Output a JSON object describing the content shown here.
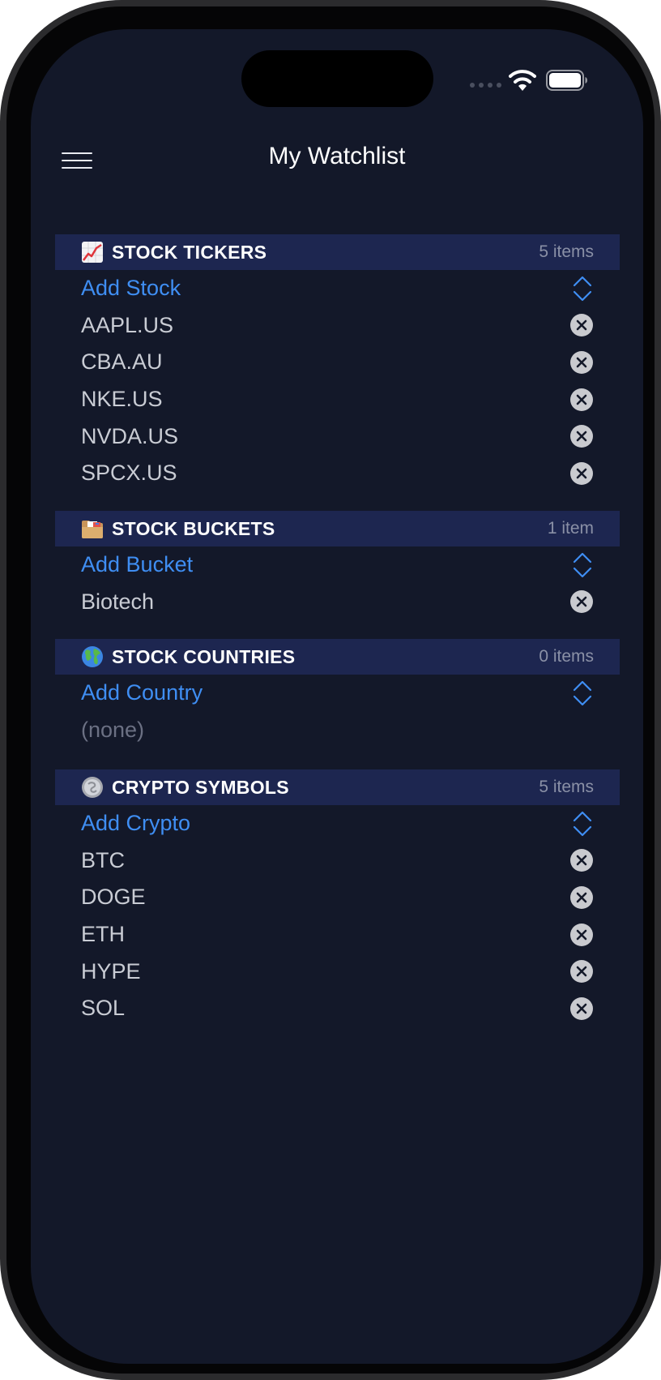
{
  "header": {
    "title": "My Watchlist"
  },
  "sections": [
    {
      "emoji": "chart-increasing-icon",
      "title": "STOCK TICKERS",
      "count": "5 items",
      "add_label": "Add Stock",
      "items": [
        "AAPL.US",
        "CBA.AU",
        "NKE.US",
        "NVDA.US",
        "SPCX.US"
      ]
    },
    {
      "emoji": "file-folder-icon",
      "title": "STOCK BUCKETS",
      "count": "1 item",
      "add_label": "Add Bucket",
      "items": [
        "Biotech"
      ]
    },
    {
      "emoji": "globe-icon",
      "title": "STOCK COUNTRIES",
      "count": "0 items",
      "add_label": "Add Country",
      "empty_label": "(none)",
      "items": []
    },
    {
      "emoji": "coin-icon",
      "title": "CRYPTO SYMBOLS",
      "count": "5 items",
      "add_label": "Add Crypto",
      "items": [
        "BTC",
        "DOGE",
        "ETH",
        "HYPE",
        "SOL"
      ]
    }
  ],
  "colors": {
    "background": "#131829",
    "section_header": "#1d2650",
    "accent": "#3f8ef3",
    "item_text": "#c9ccd4",
    "muted": "#8a90a6"
  }
}
